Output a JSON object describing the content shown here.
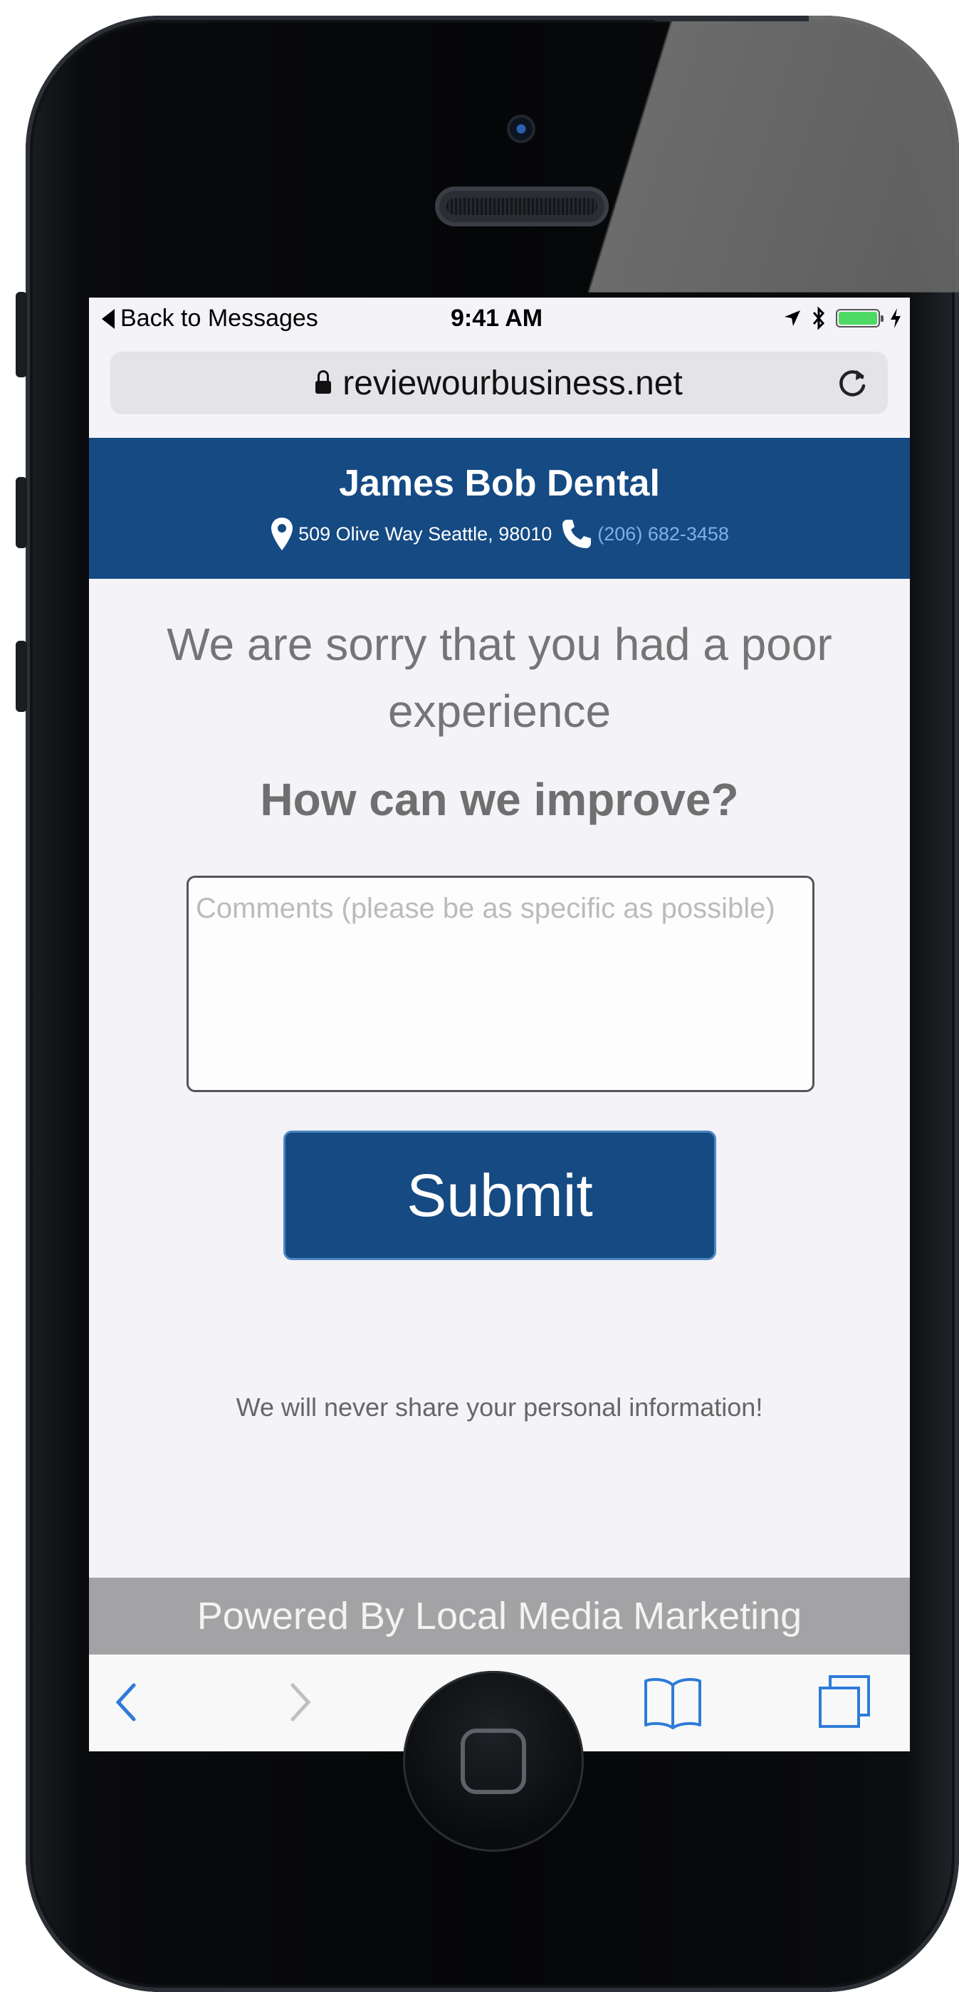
{
  "status_bar": {
    "back_label": "Back to Messages",
    "time": "9:41 AM",
    "battery_color": "#4cd964"
  },
  "browser": {
    "url": "reviewourbusiness.net",
    "icons": [
      "lock-icon",
      "reload-icon"
    ]
  },
  "business": {
    "name": "James Bob Dental",
    "address": "509 Olive Way Seattle, 98010",
    "phone": "(206) 682-3458",
    "brand_color": "#154a83"
  },
  "main": {
    "headline": "We are sorry that you had a poor experience",
    "subheading": "How can we improve?",
    "comments_placeholder": "Comments (please be as specific as possible)",
    "comments_value": "",
    "submit_label": "Submit",
    "privacy_note": "We will never share your personal information!"
  },
  "footer": {
    "powered_by": "Powered By Local Media Marketing"
  },
  "toolbar": {
    "items": [
      "back-icon",
      "forward-icon",
      "share-icon",
      "bookmarks-icon",
      "tabs-icon"
    ],
    "accent_color": "#2f7bd8"
  }
}
